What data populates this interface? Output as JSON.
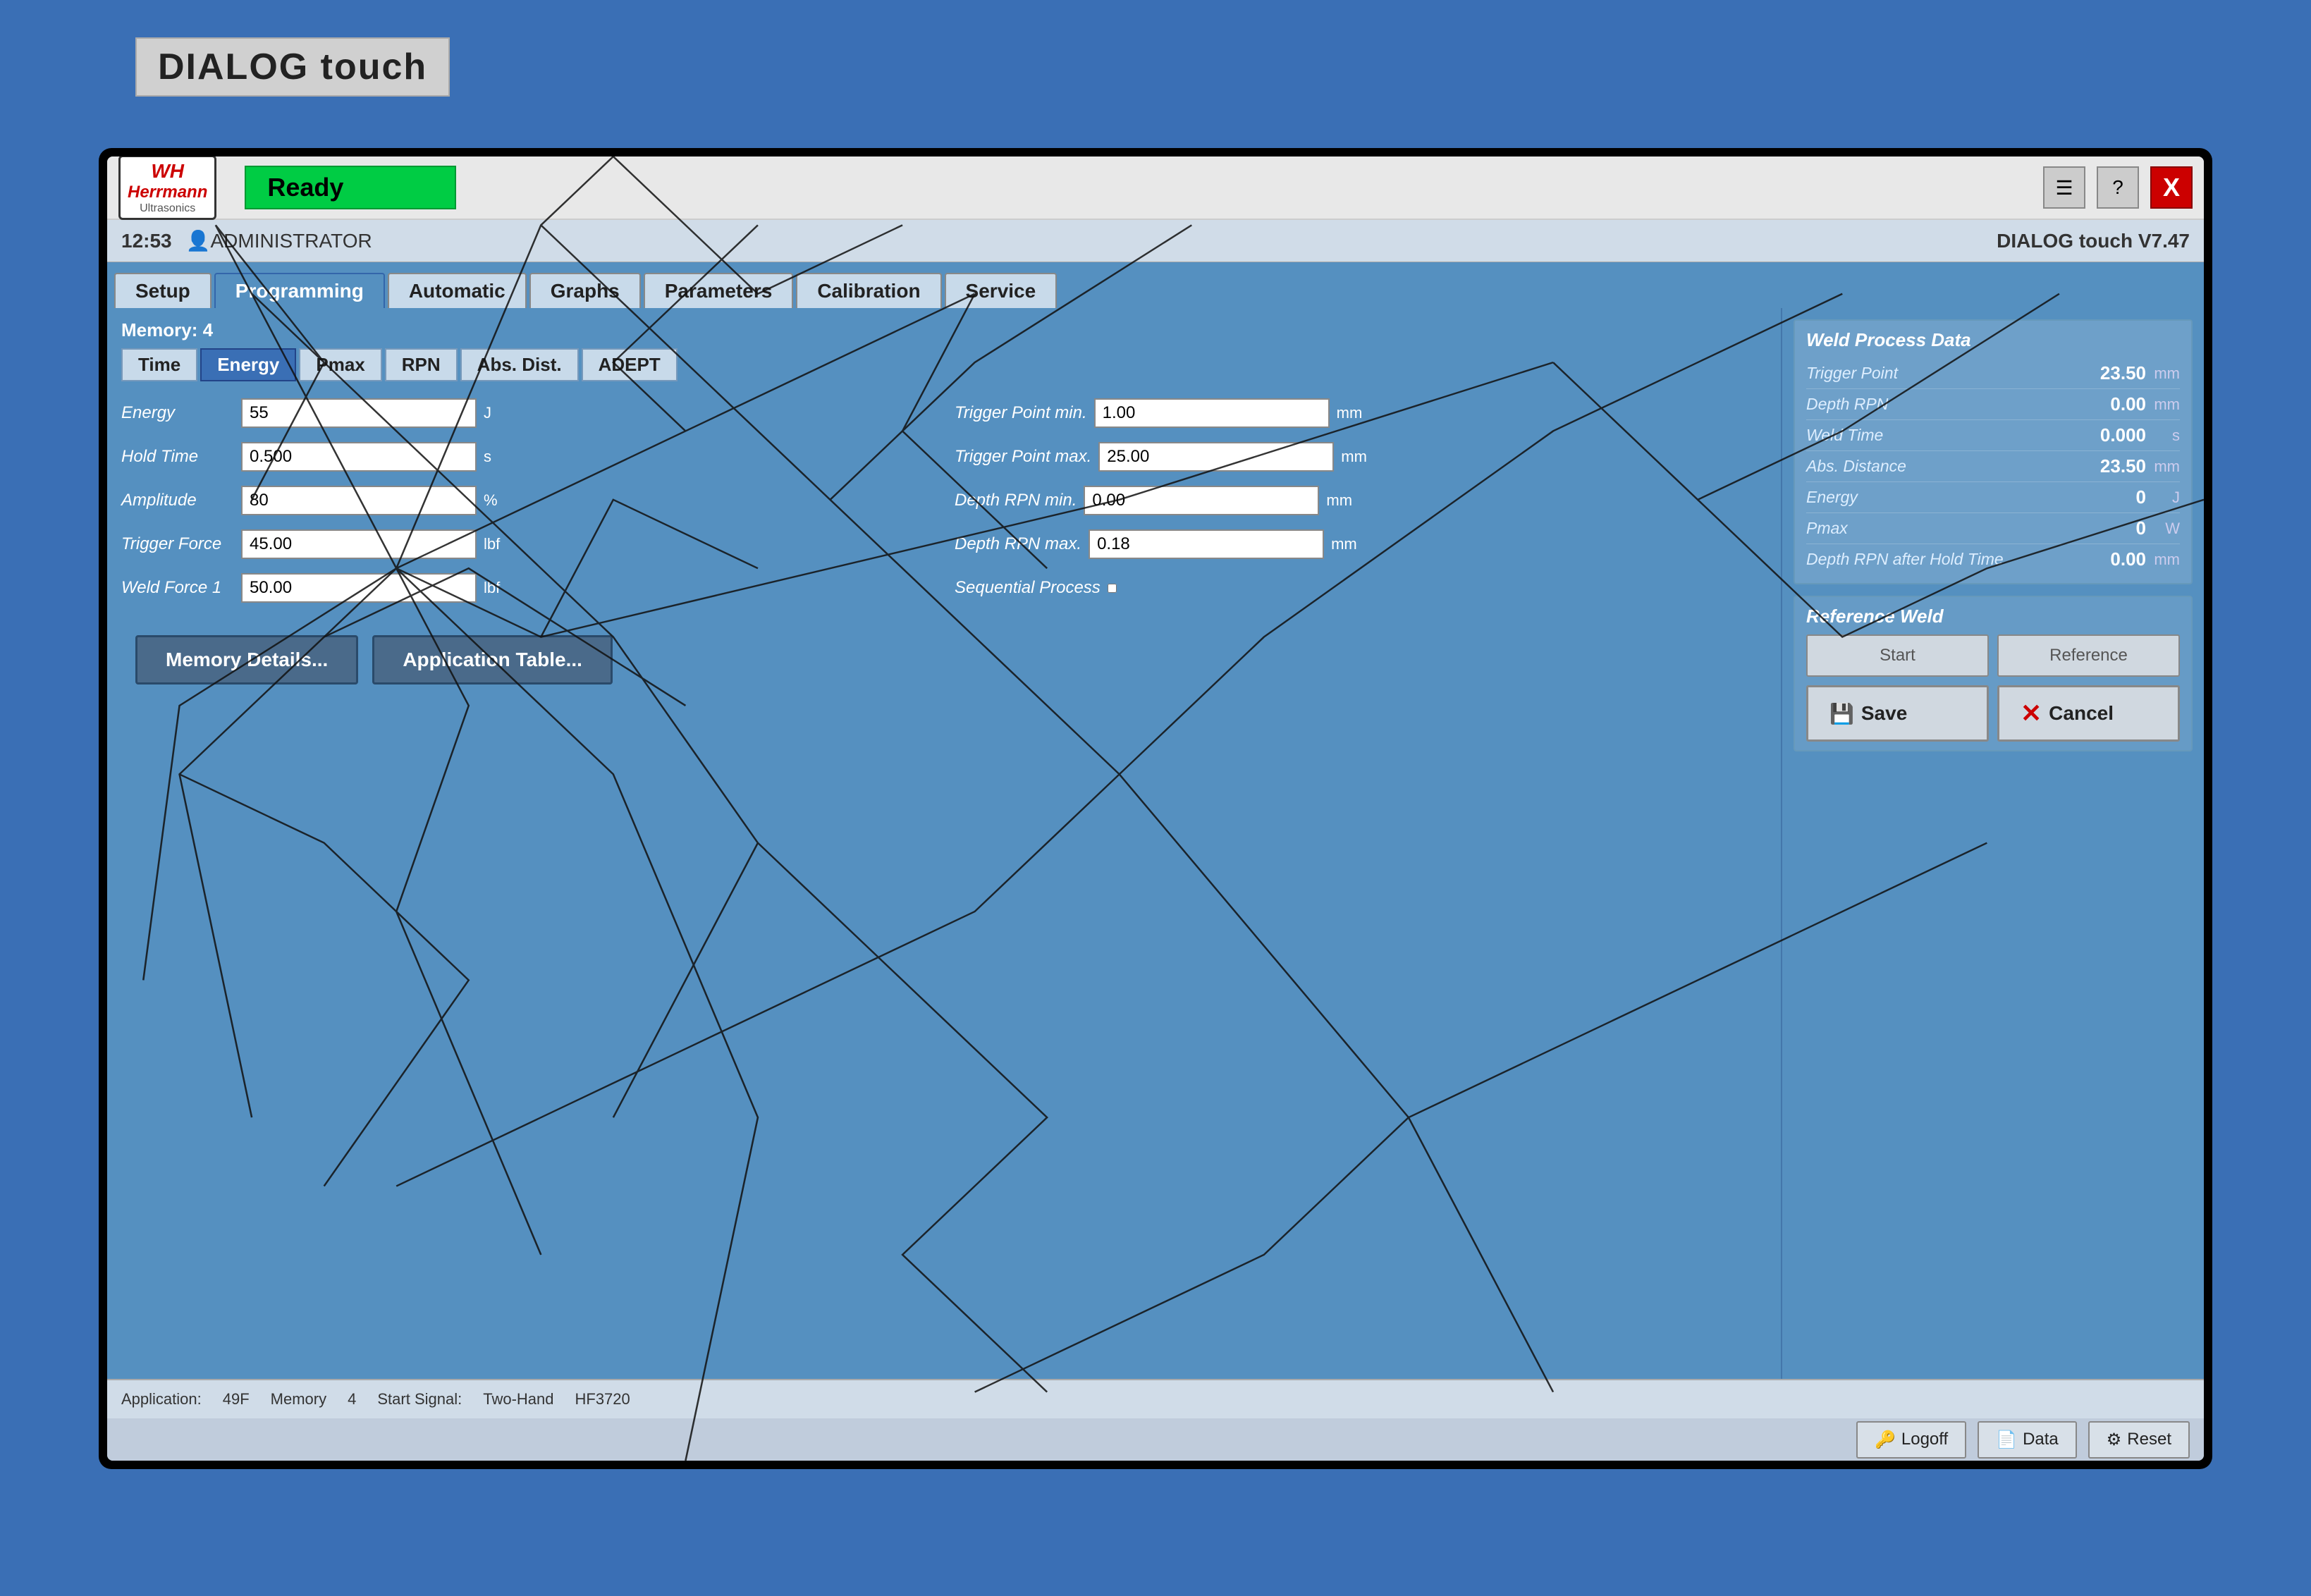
{
  "machine": {
    "title": "DIALOG touch"
  },
  "header": {
    "brand": "Herrmann",
    "brand_sub": "Ultrasonics",
    "logo_initials": "WH",
    "status": "Ready",
    "time": "12:53",
    "user_icon": "👤",
    "user": "ADMINISTRATOR",
    "version": "DIALOG touch V7.47",
    "close_label": "X"
  },
  "nav": {
    "tabs": [
      "Setup",
      "Programming",
      "Automatic",
      "Graphs",
      "Parameters",
      "Calibration",
      "Service"
    ],
    "active_tab": "Programming"
  },
  "memory": {
    "label": "Memory:",
    "value": "4"
  },
  "mode_tabs": [
    "Time",
    "Energy",
    "Pmax",
    "RPN",
    "Abs. Dist.",
    "ADEPT"
  ],
  "active_mode": "Energy",
  "form": {
    "energy_label": "Energy",
    "energy_value": "55",
    "energy_unit": "J",
    "hold_time_label": "Hold Time",
    "hold_time_value": "0.500",
    "hold_time_unit": "s",
    "amplitude_label": "Amplitude",
    "amplitude_value": "80",
    "amplitude_unit": "%",
    "trigger_force_label": "Trigger Force",
    "trigger_force_value": "45.00",
    "trigger_force_unit": "lbf",
    "weld_force_label": "Weld Force 1",
    "weld_force_value": "50.00",
    "weld_force_unit": "lbf",
    "trigger_min_label": "Trigger Point min.",
    "trigger_min_value": "1.00",
    "trigger_min_unit": "mm",
    "trigger_max_label": "Trigger Point max.",
    "trigger_max_value": "25.00",
    "trigger_max_unit": "mm",
    "depth_rpn_min_label": "Depth RPN min.",
    "depth_rpn_min_value": "0.00",
    "depth_rpn_min_unit": "mm",
    "depth_rpn_max_label": "Depth RPN max.",
    "depth_rpn_max_value": "0.18",
    "depth_rpn_max_unit": "mm",
    "sequential_label": "Sequential Process"
  },
  "buttons": {
    "memory_details": "Memory Details...",
    "application_table": "Application Table..."
  },
  "weld_process": {
    "title": "Weld Process Data",
    "rows": [
      {
        "label": "Trigger Point",
        "value": "23.50",
        "unit": "mm"
      },
      {
        "label": "Depth RPN",
        "value": "0.00",
        "unit": "mm"
      },
      {
        "label": "Weld Time",
        "value": "0.000",
        "unit": "s"
      },
      {
        "label": "Abs. Distance",
        "value": "23.50",
        "unit": "mm"
      },
      {
        "label": "Energy",
        "value": "0",
        "unit": "J"
      },
      {
        "label": "Pmax",
        "value": "0",
        "unit": "W"
      },
      {
        "label": "Depth RPN after Hold Time",
        "value": "0.00",
        "unit": "mm"
      }
    ]
  },
  "reference_weld": {
    "title": "Reference Weld",
    "start_label": "Start",
    "reference_label": "Reference"
  },
  "action_buttons": {
    "save_label": "Save",
    "cancel_label": "Cancel"
  },
  "status_bar": {
    "application": "Application:",
    "application_value": "49F",
    "memory": "Memory",
    "memory_value": "4",
    "start_signal": "Start Signal:",
    "start_signal_value": "Two-Hand",
    "device": "HF3720"
  },
  "footer_buttons": {
    "logoff": "Logoff",
    "data": "Data",
    "reset": "Reset"
  }
}
